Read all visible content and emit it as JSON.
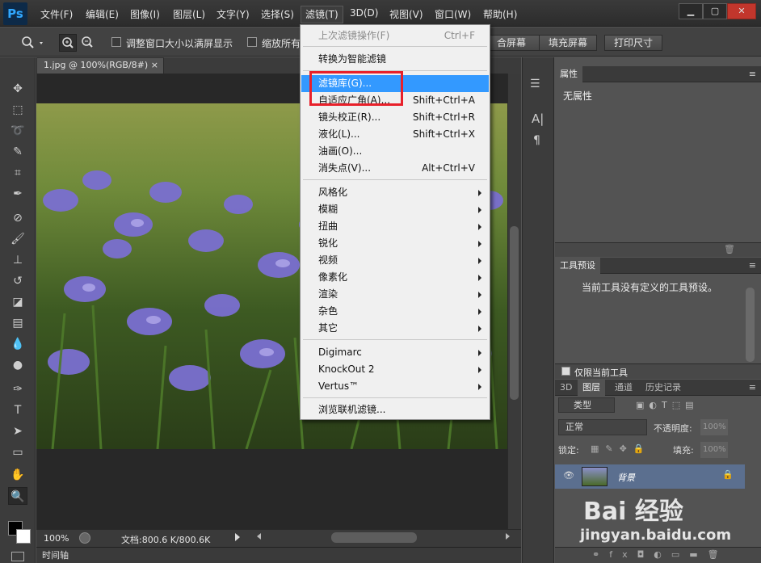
{
  "app": {
    "logo": "Ps"
  },
  "menubar": {
    "items": [
      {
        "label": "文件(F)"
      },
      {
        "label": "编辑(E)"
      },
      {
        "label": "图像(I)"
      },
      {
        "label": "图层(L)"
      },
      {
        "label": "文字(Y)"
      },
      {
        "label": "选择(S)"
      },
      {
        "label": "滤镜(T)"
      },
      {
        "label": "3D(D)"
      },
      {
        "label": "视图(V)"
      },
      {
        "label": "窗口(W)"
      },
      {
        "label": "帮助(H)"
      }
    ],
    "active": "滤镜(T)"
  },
  "window_controls": {
    "minimize": "▁",
    "restore": "▢",
    "close": "✕"
  },
  "options_bar": {
    "checkbox1_label": "调整窗口大小以满屏显示",
    "checkbox2_label": "缩放所有",
    "fit_screen_partial": "合屏幕",
    "fill_screen": "填充屏幕",
    "print_size": "打印尺寸"
  },
  "document": {
    "tab_title": "1.jpg @ 100%(RGB/8#)",
    "tab_close": "×",
    "zoom": "100%",
    "doc_info": "文档:800.6 K/800.6K"
  },
  "timeline": {
    "label": "时间轴"
  },
  "filter_menu": {
    "items": [
      {
        "label": "上次滤镜操作(F)",
        "shortcut": "Ctrl+F",
        "disabled": true
      },
      {
        "label": "转换为智能滤镜"
      },
      {
        "label": "滤镜库(G)...",
        "highlighted": true
      },
      {
        "label": "自适应广角(A)...",
        "shortcut": "Shift+Ctrl+A"
      },
      {
        "label": "镜头校正(R)...",
        "shortcut": "Shift+Ctrl+R"
      },
      {
        "label": "液化(L)...",
        "shortcut": "Shift+Ctrl+X"
      },
      {
        "label": "油画(O)..."
      },
      {
        "label": "消失点(V)...",
        "shortcut": "Alt+Ctrl+V"
      },
      {
        "label": "风格化",
        "submenu": true
      },
      {
        "label": "模糊",
        "submenu": true
      },
      {
        "label": "扭曲",
        "submenu": true
      },
      {
        "label": "锐化",
        "submenu": true
      },
      {
        "label": "视频",
        "submenu": true
      },
      {
        "label": "像素化",
        "submenu": true
      },
      {
        "label": "渲染",
        "submenu": true
      },
      {
        "label": "杂色",
        "submenu": true
      },
      {
        "label": "其它",
        "submenu": true
      },
      {
        "label": "Digimarc",
        "submenu": true
      },
      {
        "label": "KnockOut 2",
        "submenu": true
      },
      {
        "label": "Vertus™",
        "submenu": true
      },
      {
        "label": "浏览联机滤镜..."
      }
    ]
  },
  "properties_panel": {
    "tab": "属性",
    "body": "无属性"
  },
  "tool_presets_panel": {
    "tab": "工具预设",
    "body": "当前工具没有定义的工具预设。",
    "checkbox_label": "仅限当前工具"
  },
  "layers_panel": {
    "tabs": [
      "3D",
      "图层",
      "通道",
      "历史记录"
    ],
    "active_tab": "图层",
    "filter_kind": "类型",
    "blend_mode": "正常",
    "opacity_label": "不透明度:",
    "opacity_value": "100%",
    "lock_label": "锁定:",
    "fill_label": "填充:",
    "fill_value": "100%",
    "layer_name": "背景"
  },
  "watermark": {
    "logo": "Bai 经验",
    "url": "jingyan.baidu.com"
  },
  "colors": {
    "highlight": "#3399ff",
    "red_box": "#e8202a"
  }
}
